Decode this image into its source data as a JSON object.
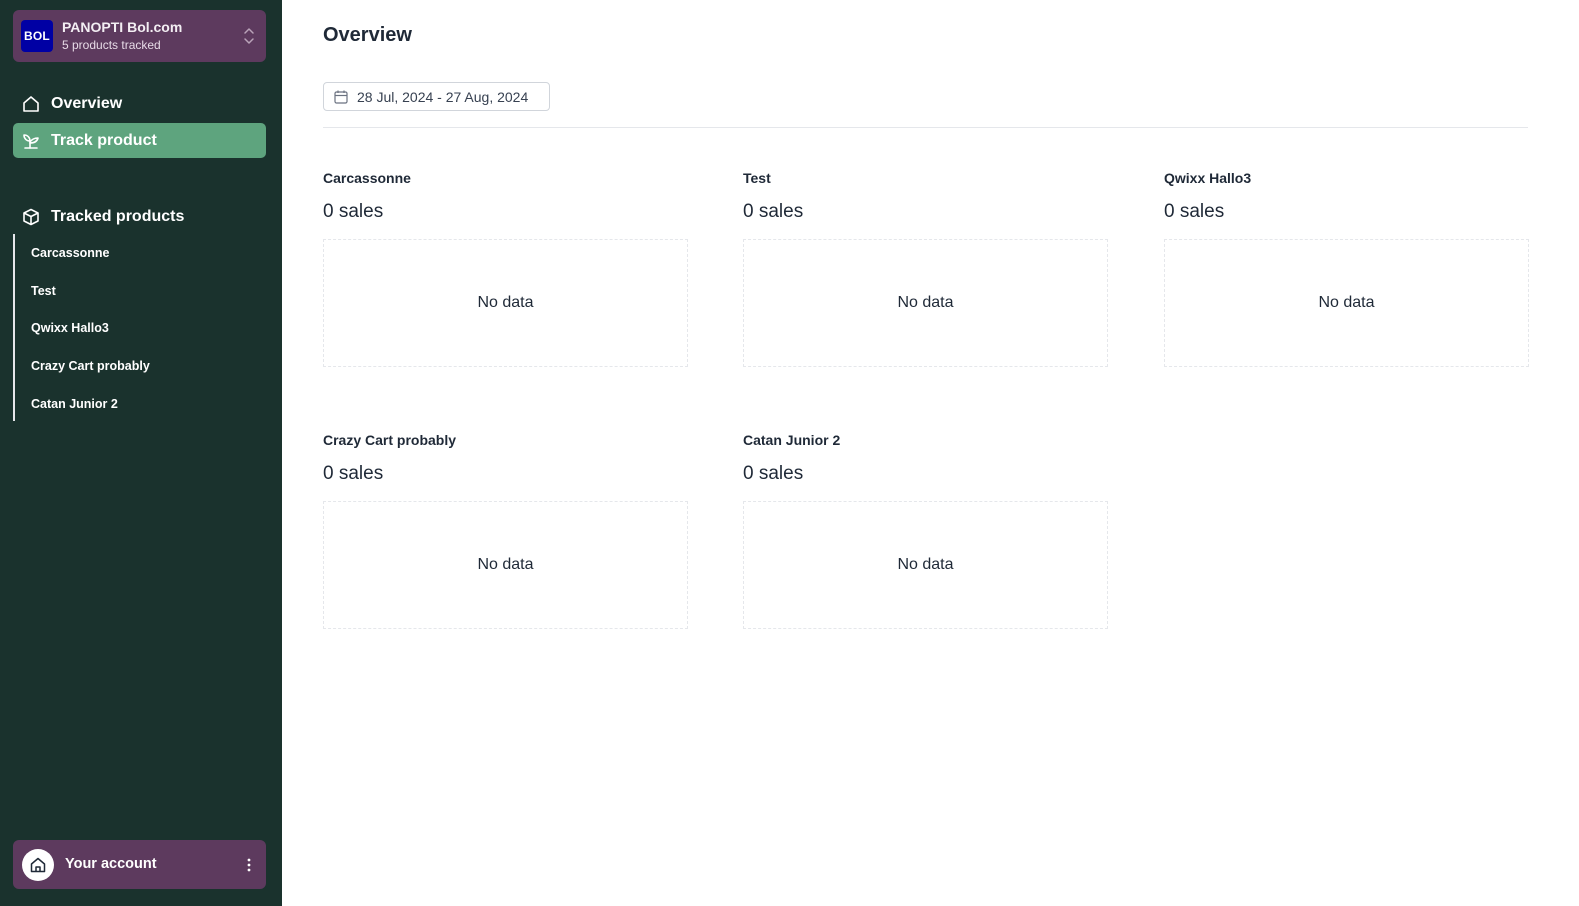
{
  "store": {
    "logo_text": "BOL",
    "name": "PANOPTI Bol.com",
    "subtitle": "5 products tracked"
  },
  "nav": {
    "overview": "Overview",
    "track_product": "Track product",
    "tracked_products_title": "Tracked products"
  },
  "tracked_products": [
    "Carcassonne",
    "Test",
    "Qwixx Hallo3",
    "Crazy Cart probably",
    "Catan Junior 2"
  ],
  "account": {
    "label": "Your account"
  },
  "main": {
    "title": "Overview",
    "date_range": "28 Jul, 2024 - 27 Aug, 2024"
  },
  "cards": [
    {
      "title": "Carcassonne",
      "sales": "0 sales",
      "chart_text": "No data"
    },
    {
      "title": "Test",
      "sales": "0 sales",
      "chart_text": "No data"
    },
    {
      "title": "Qwixx Hallo3",
      "sales": "0 sales",
      "chart_text": "No data"
    },
    {
      "title": "Crazy Cart probably",
      "sales": "0 sales",
      "chart_text": "No data"
    },
    {
      "title": "Catan Junior 2",
      "sales": "0 sales",
      "chart_text": "No data"
    }
  ],
  "colors": {
    "sidebar_bg": "#1a322d",
    "store_bg": "#5d3a5e",
    "active_nav_bg": "#5ea47e",
    "logo_bg": "#0000a4"
  },
  "icons": {
    "overview": "home-icon",
    "track_product": "sprout-icon",
    "tracked_products": "box-icon",
    "date": "calendar-icon",
    "store_switch": "chevron-up-down-icon",
    "account_avatar": "home-icon",
    "account_menu": "more-vertical-icon"
  }
}
